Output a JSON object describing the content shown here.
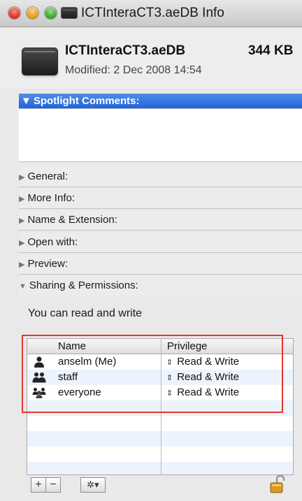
{
  "window": {
    "title": "ICTInteraCT3.aeDB Info"
  },
  "file": {
    "name": "ICTInteraCT3.aeDB",
    "size": "344 KB",
    "modified": "Modified: 2 Dec 2008 14:54"
  },
  "spotlight": {
    "label": "Spotlight Comments:",
    "value": ""
  },
  "sections": {
    "general": "General:",
    "more_info": "More Info:",
    "name_extension": "Name & Extension:",
    "open_with": "Open with:",
    "preview": "Preview:",
    "sharing": "Sharing & Permissions:"
  },
  "sharing": {
    "status": "You can read and write",
    "columns": {
      "name": "Name",
      "privilege": "Privilege"
    },
    "rows": [
      {
        "name": "anselm (Me)",
        "privilege": "Read & Write",
        "icon": "single-user-icon"
      },
      {
        "name": "staff",
        "privilege": "Read & Write",
        "icon": "group-icon"
      },
      {
        "name": "everyone",
        "privilege": "Read & Write",
        "icon": "everyone-icon"
      }
    ]
  },
  "toolbar": {
    "add": "+",
    "remove": "−",
    "action": "✲▾"
  },
  "colors": {
    "highlight_outline": "#e8352a",
    "spotlight_header": "#1f63d9",
    "row_stripe": "#edf3fe"
  }
}
